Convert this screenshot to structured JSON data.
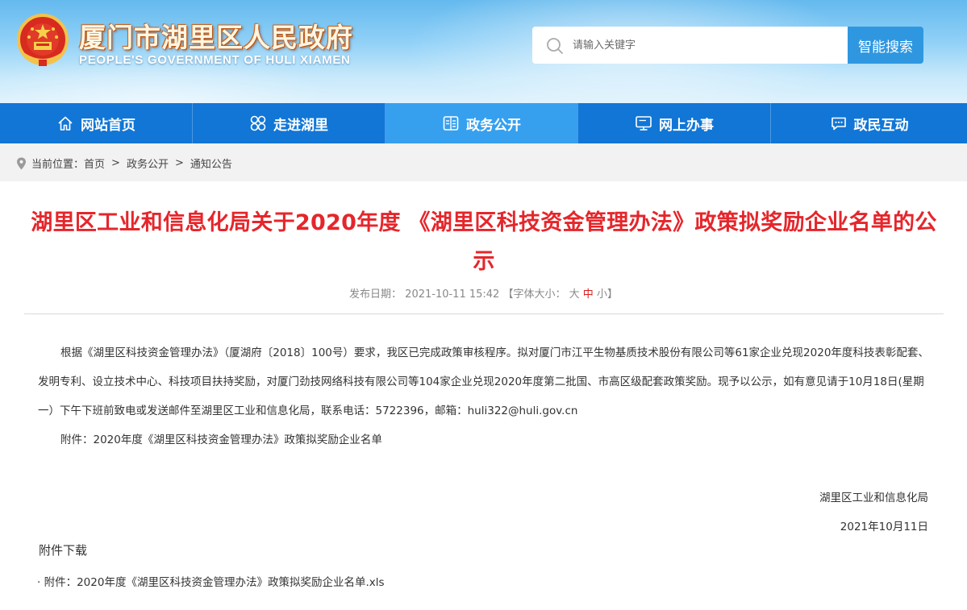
{
  "header": {
    "site_title_cn": "厦门市湖里区人民政府",
    "site_title_en": "PEOPLE'S GOVERNMENT OF HULI XIAMEN",
    "search_placeholder": "请输入关键字",
    "search_button": "智能搜索"
  },
  "nav": {
    "items": [
      {
        "label": "网站首页",
        "icon": "home-icon"
      },
      {
        "label": "走进湖里",
        "icon": "clover-icon"
      },
      {
        "label": "政务公开",
        "icon": "document-list-icon",
        "active": true
      },
      {
        "label": "网上办事",
        "icon": "monitor-icon"
      },
      {
        "label": "政民互动",
        "icon": "chat-icon"
      }
    ]
  },
  "breadcrumb": {
    "prefix": "当前位置：",
    "items": [
      "首页",
      "政务公开",
      "通知公告"
    ],
    "separator": ">"
  },
  "article": {
    "title": "湖里区工业和信息化局关于2020年度 《湖里区科技资金管理办法》政策拟奖励企业名单的公示",
    "date_label": "发布日期：",
    "date": "2021-10-11 15:42",
    "font_size_open": "【字体大小：",
    "font_size_large": "大",
    "font_size_medium": "中",
    "font_size_small": "小",
    "font_size_close": "】",
    "paragraph1": "根据《湖里区科技资金管理办法》（厦湖府〔2018〕100号）要求，我区已完成政策审核程序。拟对厦门市江平生物基质技术股份有限公司等61家企业兑现2020年度科技表彰配套、发明专利、设立技术中心、科技项目扶持奖励，对厦门劲技网络科技有限公司等104家企业兑现2020年度第二批国、市高区级配套政策奖励。现予以公示，如有意见请于10月18日(星期一）下午下班前致电或发送邮件至湖里区工业和信息化局，联系电话：5722396，邮箱：huli322@huli.gov.cn",
    "paragraph2": "附件：2020年度《湖里区科技资金管理办法》政策拟奖励企业名单",
    "signature_org": "湖里区工业和信息化局",
    "signature_date": "2021年10月11日",
    "attachments_heading": "附件下载",
    "attachment_link": "· 附件：2020年度《湖里区科技资金管理办法》政策拟奖励企业名单.xls"
  },
  "colors": {
    "nav_bg": "#1176d6",
    "nav_active": "#36a0ef",
    "title_red": "#e5262b",
    "search_button": "#2f97e0"
  }
}
